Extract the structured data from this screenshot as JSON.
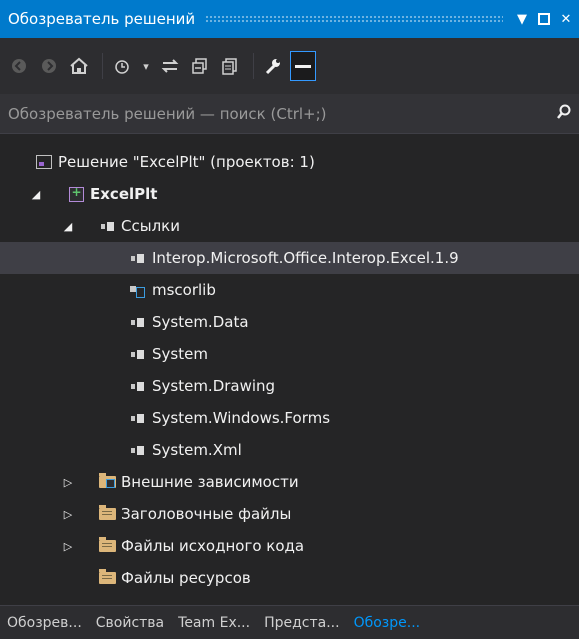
{
  "window": {
    "title": "Обозреватель решений",
    "buttons": [
      "pin-dropdown",
      "maximize",
      "close"
    ]
  },
  "toolbar": {
    "buttons": [
      {
        "name": "back-icon",
        "enabled": false
      },
      {
        "name": "forward-icon",
        "enabled": false
      },
      {
        "name": "home-icon",
        "enabled": true
      },
      {
        "name": "pending-changes-icon",
        "enabled": true
      },
      {
        "name": "sync-icon",
        "enabled": true
      },
      {
        "name": "collapse-all-icon",
        "enabled": true
      },
      {
        "name": "show-all-files-icon",
        "enabled": true
      },
      {
        "name": "properties-icon",
        "enabled": true
      },
      {
        "name": "preview-icon",
        "enabled": true
      }
    ]
  },
  "search": {
    "placeholder": "Обозреватель решений — поиск (Ctrl+;)"
  },
  "tree": [
    {
      "label": "Решение \"ExcelPlt\"  (проектов: 1)",
      "icon": "solution-icon",
      "level": 0,
      "expander": "none"
    },
    {
      "label": "ExcelPlt",
      "icon": "project-icon",
      "level": 1,
      "expander": "expanded",
      "bold": true
    },
    {
      "label": "Ссылки",
      "icon": "references-icon",
      "level": 2,
      "expander": "expanded"
    },
    {
      "label": "Interop.Microsoft.Office.Interop.Excel.1.9",
      "icon": "reference-icon",
      "level": 3,
      "expander": "none",
      "selected": true
    },
    {
      "label": "mscorlib",
      "icon": "library-icon",
      "level": 3,
      "expander": "none"
    },
    {
      "label": "System.Data",
      "icon": "reference-icon",
      "level": 3,
      "expander": "none"
    },
    {
      "label": "System",
      "icon": "reference-icon",
      "level": 3,
      "expander": "none"
    },
    {
      "label": "System.Drawing",
      "icon": "reference-icon",
      "level": 3,
      "expander": "none"
    },
    {
      "label": "System.Windows.Forms",
      "icon": "reference-icon",
      "level": 3,
      "expander": "none"
    },
    {
      "label": "System.Xml",
      "icon": "reference-icon",
      "level": 3,
      "expander": "none"
    },
    {
      "label": "Внешние зависимости",
      "icon": "external-deps-folder-icon",
      "level": 2,
      "expander": "collapsed"
    },
    {
      "label": "Заголовочные файлы",
      "icon": "folder-icon",
      "level": 2,
      "expander": "collapsed"
    },
    {
      "label": "Файлы исходного кода",
      "icon": "folder-icon",
      "level": 2,
      "expander": "collapsed"
    },
    {
      "label": "Файлы ресурсов",
      "icon": "folder-icon",
      "level": 2,
      "expander": "none"
    }
  ],
  "tabs": [
    {
      "label": "Обозрев...",
      "active": false
    },
    {
      "label": "Свойства",
      "active": false
    },
    {
      "label": "Team Ex...",
      "active": false
    },
    {
      "label": "Предста...",
      "active": false
    },
    {
      "label": "Обозре...",
      "active": true
    }
  ],
  "colors": {
    "accent": "#007acc",
    "background": "#252526",
    "selection": "#3f3f46",
    "active_tab": "#0097fb"
  }
}
